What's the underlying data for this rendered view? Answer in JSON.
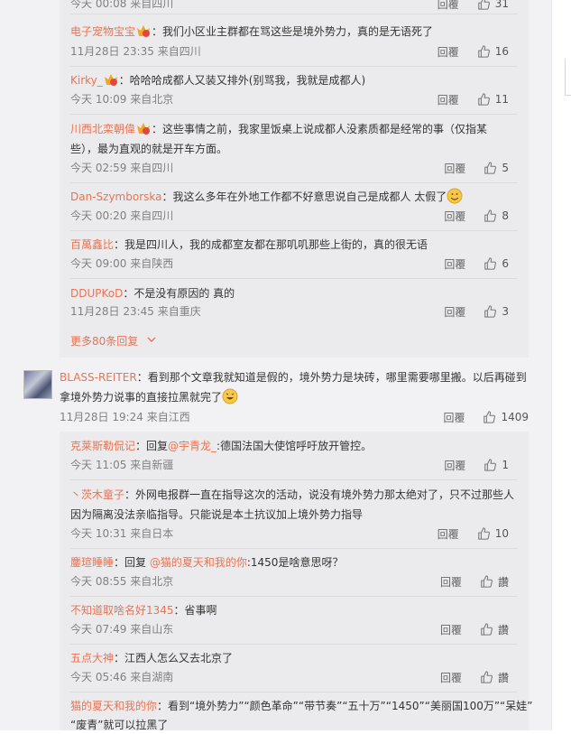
{
  "top_item": {
    "time": "今天 00:08 来自四川",
    "reply": "回覆",
    "likes": "31"
  },
  "sub_replies_1": [
    {
      "user": "电子宠物宝宝",
      "text": "：我们小区业主群都在骂这些是境外势力，真的是无语死了",
      "time": "11月28日 23:35 来自四川",
      "reply": "回覆",
      "likes": "16",
      "badge": true
    },
    {
      "user": "Kirky_",
      "text": "：哈哈哈成都人又装又排外(别骂我，我就是成都人)",
      "time": "今天 10:09 来自北京",
      "reply": "回覆",
      "likes": "11",
      "badge": true
    },
    {
      "user": "川西北栾朝偉",
      "text": "：这些事情之前，我家里饭桌上说成都人没素质都是经常的事（仅指某",
      "text2": "些），最为直观的就是开车方面。",
      "time": "今天 02:59 来自四川",
      "reply": "回覆",
      "likes": "5",
      "badge": true
    },
    {
      "user": "Dan-Szymborska",
      "text": "：我这么多年在外地工作都不好意思说自己是成都人 太假了",
      "time": "今天 00:20 来自四川",
      "reply": "回覆",
      "likes": "8",
      "emoji": true
    },
    {
      "user": "百萬鑫比",
      "text": "：我是四川人，我的成都室友都在那叽叽那些上街的，真的很无语",
      "time": "今天 09:00 来自陕西",
      "reply": "回覆",
      "likes": "6"
    },
    {
      "user": "DDUPKoD",
      "text": "：不是没有原因的 真的",
      "time": "11月28日 23:45 来自重庆",
      "reply": "回覆",
      "likes": "3"
    }
  ],
  "more_replies": "更多80条回复",
  "main_comment": {
    "user": "BLASS-REITER",
    "text": "：看到那个文章我就知道是假的，境外势力是块砖，哪里需要哪里搬。以后再碰到",
    "text2": "拿境外势力说事的直接拉黑就完了",
    "time": "11月28日 19:24 来自江西",
    "reply": "回覆",
    "likes": "1409"
  },
  "sub_replies_2": [
    {
      "user": "克莱斯勒侃记",
      "pre": "：回复",
      "mention": "@宇青龙_",
      "text": ":德国法国大使馆呼吁放开管控。",
      "time": "今天 11:05 来自新疆",
      "reply": "回覆",
      "likes": "1"
    },
    {
      "user": "丶茨木童子",
      "text": "：外网电报群一直在指导这次的活动，说没有境外势力那太绝对了，只不过那些人",
      "text2": "因为隔离没法亲临指导。只能说是本土抗议加上境外势力指导",
      "time": "今天 10:31 来自日本",
      "reply": "回覆",
      "likes": "10"
    },
    {
      "user": "鏖瑄睡睡",
      "pre": "：回复 ",
      "mention": "@猫的夏天和我的你",
      "text": ":1450是啥意思呀？",
      "time": "今天 08:55 来自北京",
      "reply": "回覆",
      "likes": "讚"
    },
    {
      "user": "不知道取啥名好1345",
      "text": "：省事啊",
      "time": "今天 07:49 来自山东",
      "reply": "回覆",
      "likes": "讚"
    },
    {
      "user": "五点大神",
      "text": "：江西人怎么又去北京了",
      "time": "今天 05:46 来自湖南",
      "reply": "回覆",
      "likes": "讚"
    },
    {
      "user": "猫的夏天和我的你",
      "text": "：看到“境外势力”“颜色革命”“带节奏”“五十万”“1450”“美丽国100万”“呆娃”",
      "text2": "“废青”就可以拉黑了"
    }
  ]
}
